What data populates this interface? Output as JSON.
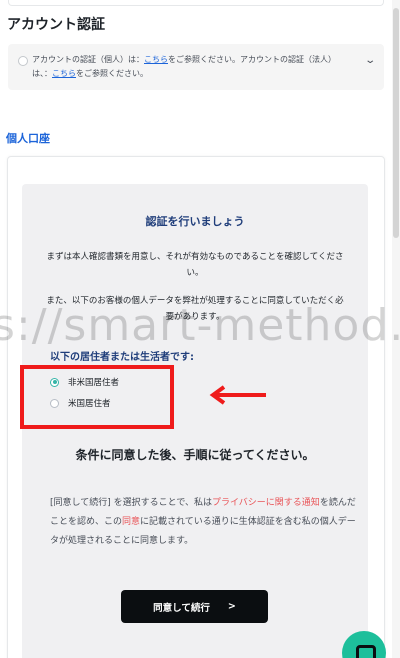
{
  "account_verification": {
    "title": "アカウント認証",
    "info_part1": "アカウントの認証（個人）は：",
    "info_link1": "こちら",
    "info_part2": "をご参照ください。アカウントの認証（法人）は、：",
    "info_link2": "こちら",
    "info_part3": "をご参照ください。"
  },
  "personal_account_link": "個人口座",
  "card": {
    "title": "認証を行いましょう",
    "para1": "まずは本人確認書類を用意し、それが有効なものであることを確認してください。",
    "para2": "また、以下のお客様の個人データを弊社が処理することに同意していただく必要があります。",
    "residency_label": "以下の居住者または生活者です:",
    "options": [
      {
        "label": "非米国居住者",
        "selected": true
      },
      {
        "label": "米国居住者",
        "selected": false
      }
    ],
    "emphasis": "条件に同意した後、手順に従ってください。",
    "consent_part1": "[同意して続行] を選択することで、私は",
    "consent_link1": "プライバシーに関する通知",
    "consent_part2": "を読んだことを認め、この",
    "consent_link2": "同意",
    "consent_part3": "に記載されている通りに生体認証を含む私の個人データが処理されることに同意します。",
    "button_label": "同意して続行",
    "button_arrow": ">"
  },
  "watermark_text": "s://smart-method.c",
  "colors": {
    "accent_teal": "#35b5a8",
    "annotation_red": "#ef1b1b",
    "link_blue": "#1c64d9",
    "chat_green": "#1dbf9b"
  }
}
